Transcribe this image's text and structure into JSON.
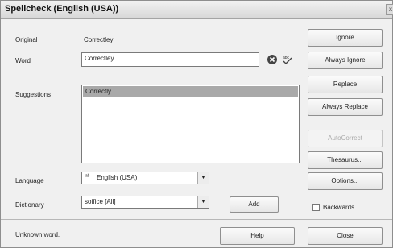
{
  "window": {
    "title": "Spellcheck (English (USA))",
    "close_glyph": "x"
  },
  "labels": {
    "original": "Original",
    "word": "Word",
    "suggestions": "Suggestions",
    "language": "Language",
    "dictionary": "Dictionary"
  },
  "original_value": "Correctley",
  "word_value": "Correctley",
  "suggestions": [
    "Correctly"
  ],
  "language": {
    "flag_glyph": "ᵃᵇ",
    "value": "English (USA)"
  },
  "dictionary": {
    "value": "soffice [All]"
  },
  "buttons": {
    "ignore": "Ignore",
    "always_ignore": "Always Ignore",
    "replace": "Replace",
    "always_replace": "Always Replace",
    "autocorrect": "AutoCorrect",
    "thesaurus": "Thesaurus...",
    "options": "Options...",
    "add": "Add",
    "help": "Help",
    "close": "Close"
  },
  "backwards": {
    "label": "Backwards",
    "checked": false
  },
  "status": "Unknown word.",
  "icons": {
    "clear": "x-circle-icon",
    "dictionary_lookup": "abc-check-icon"
  }
}
